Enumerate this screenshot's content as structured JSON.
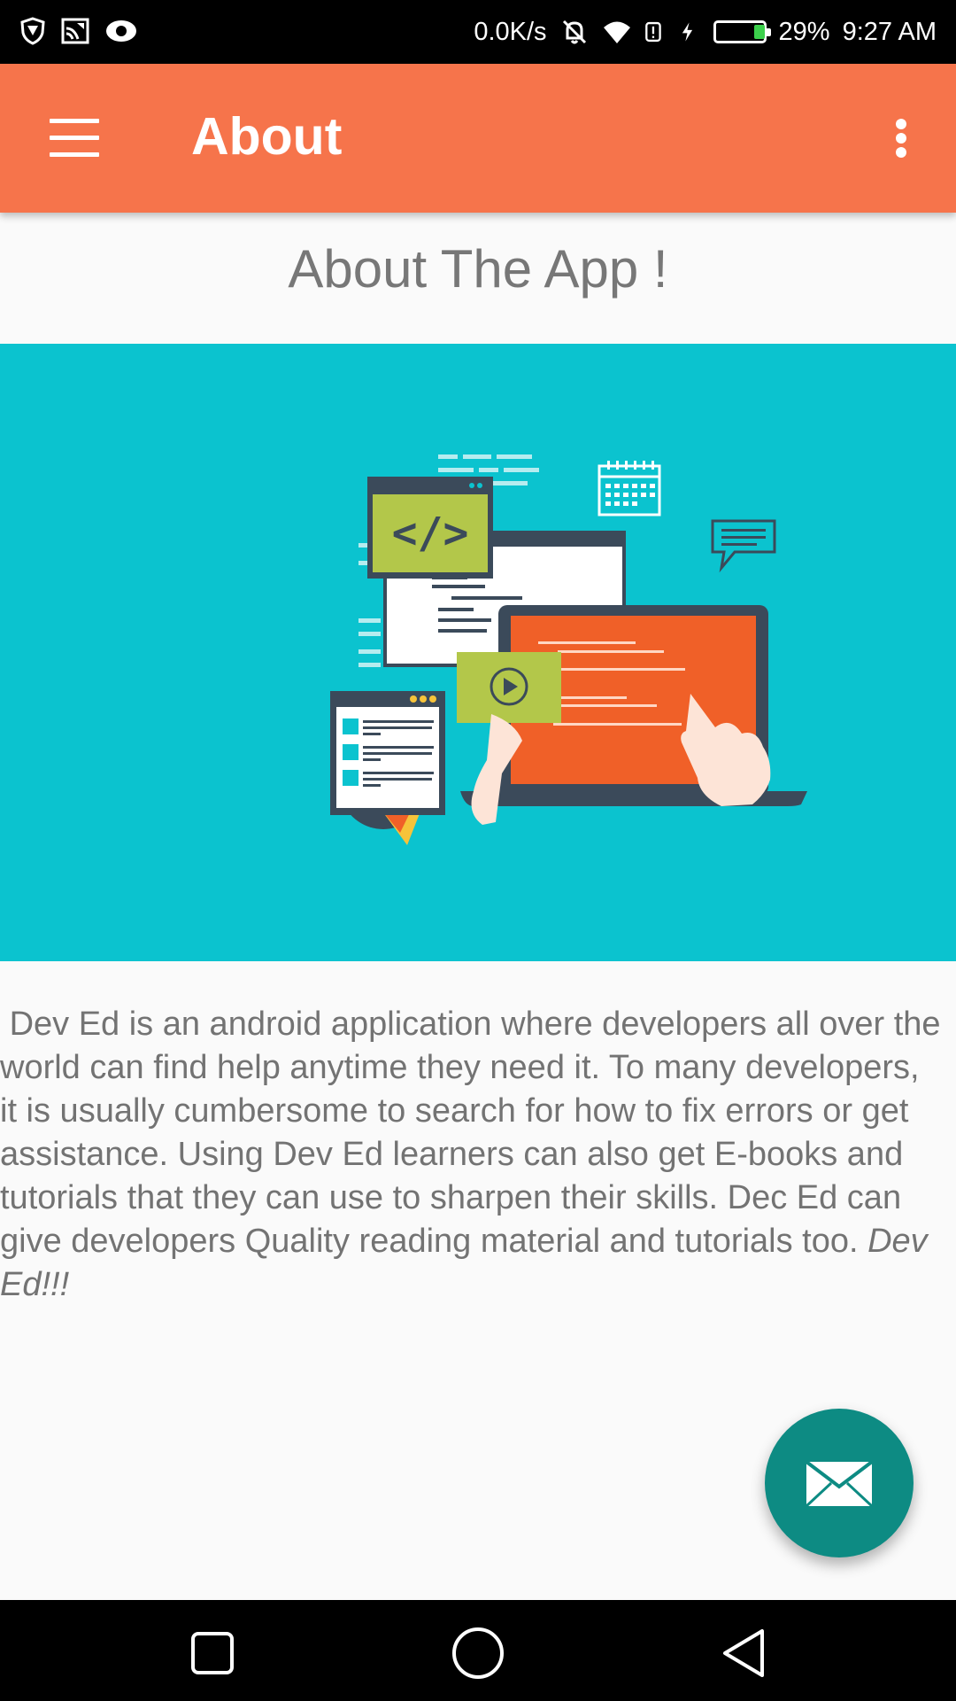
{
  "status_bar": {
    "left_icons": [
      "shield-icon",
      "cast-icon",
      "eye-icon"
    ],
    "network_speed": "0.0K/s",
    "right_icons": [
      "bell-off-icon",
      "wifi-icon",
      "alert-icon",
      "charging-icon",
      "battery-icon"
    ],
    "battery_percent": "29%",
    "battery_level": 0.29,
    "time": "9:27 AM"
  },
  "app_bar": {
    "title": "About",
    "menu_icon": "hamburger-menu-icon",
    "overflow_icon": "more-vert-icon",
    "color": "#f6744b"
  },
  "main": {
    "heading": "About The App !",
    "hero": {
      "background": "#0bc3cf",
      "code_tag": "</>"
    },
    "body": "Dev Ed is an android application where developers all over the world can find help anytime they need it. To many developers, it is usually cumbersome to search for how to fix errors or get assistance. Using Dev Ed learners can also get E-books and tutorials that they can use to sharpen their skills. Dec Ed can give developers Quality reading material and tutorials too.",
    "body_emphasis": "Dev Ed!!!"
  },
  "fab": {
    "icon": "mail-icon",
    "color": "#0d8b83"
  },
  "nav_bar": {
    "icons": [
      "recent-apps-icon",
      "home-icon",
      "back-icon"
    ]
  }
}
